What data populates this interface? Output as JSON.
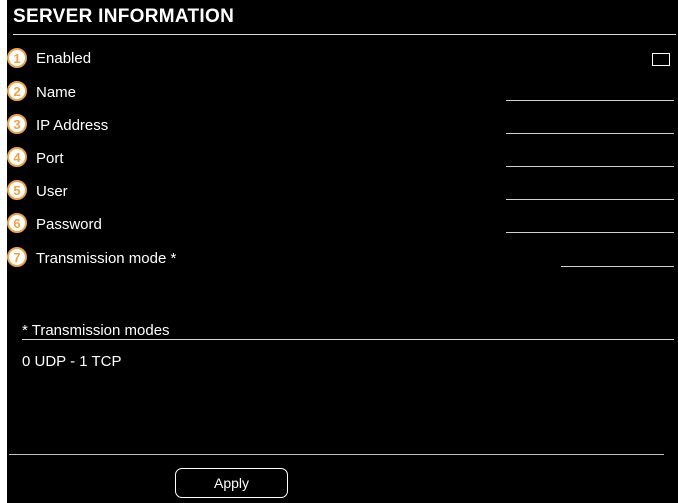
{
  "panel": {
    "title": "SERVER INFORMATION"
  },
  "fields": [
    {
      "badge": "1",
      "label": "Enabled",
      "control": "checkbox",
      "checked": false
    },
    {
      "badge": "2",
      "label": "Name",
      "control": "text",
      "value": ""
    },
    {
      "badge": "3",
      "label": "IP Address",
      "control": "text",
      "value": ""
    },
    {
      "badge": "4",
      "label": "Port",
      "control": "text",
      "value": ""
    },
    {
      "badge": "5",
      "label": "User",
      "control": "text",
      "value": ""
    },
    {
      "badge": "6",
      "label": "Password",
      "control": "text",
      "value": ""
    },
    {
      "badge": "7",
      "label": "Transmission mode *",
      "control": "text",
      "value": ""
    }
  ],
  "modes": {
    "title": "* Transmission modes",
    "text": "0 UDP - 1 TCP"
  },
  "actions": {
    "apply_label": "Apply"
  },
  "colors": {
    "background": "#000000",
    "text": "#ffffff",
    "badge_accent": "#f0a24a"
  }
}
